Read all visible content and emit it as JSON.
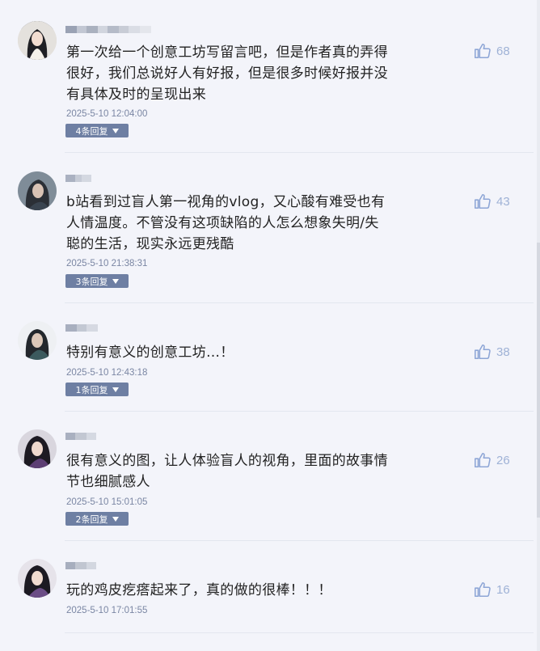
{
  "comments": [
    {
      "text": "第一次给一个创意工坊写留言吧，但是作者真的弄得很好，我们总说好人有好报，但是很多时候好报并没有具体及时的呈现出来",
      "time": "2025-5-10 12:04:00",
      "reply_label": "4条回复",
      "likes": "68"
    },
    {
      "text": "b站看到过盲人第一视角的vlog，又心酸有难受也有人情温度。不管没有这项缺陷的人怎么想象失明/失聪的生活，现实永远更残酷",
      "time": "2025-5-10 21:38:31",
      "reply_label": "3条回复",
      "likes": "43"
    },
    {
      "text": "特别有意义的创意工坊…！",
      "time": "2025-5-10 12:43:18",
      "reply_label": "1条回复",
      "likes": "38"
    },
    {
      "text": "很有意义的图，让人体验盲人的视角，里面的故事情节也细腻感人",
      "time": "2025-5-10 15:01:05",
      "reply_label": "2条回复",
      "likes": "26"
    },
    {
      "text": "玩的鸡皮疙瘩起来了，真的做的很棒！！！",
      "time": "2025-5-10 17:01:55",
      "reply_label": "",
      "likes": "16"
    }
  ],
  "colors": {
    "background": "#f3f4fa",
    "reply_button": "#6e7fa3",
    "timestamp": "#7a86a3",
    "like": "#9fb2d6"
  },
  "icons": {
    "like": "thumbs-up-icon",
    "reply_caret": "caret-down-icon"
  }
}
